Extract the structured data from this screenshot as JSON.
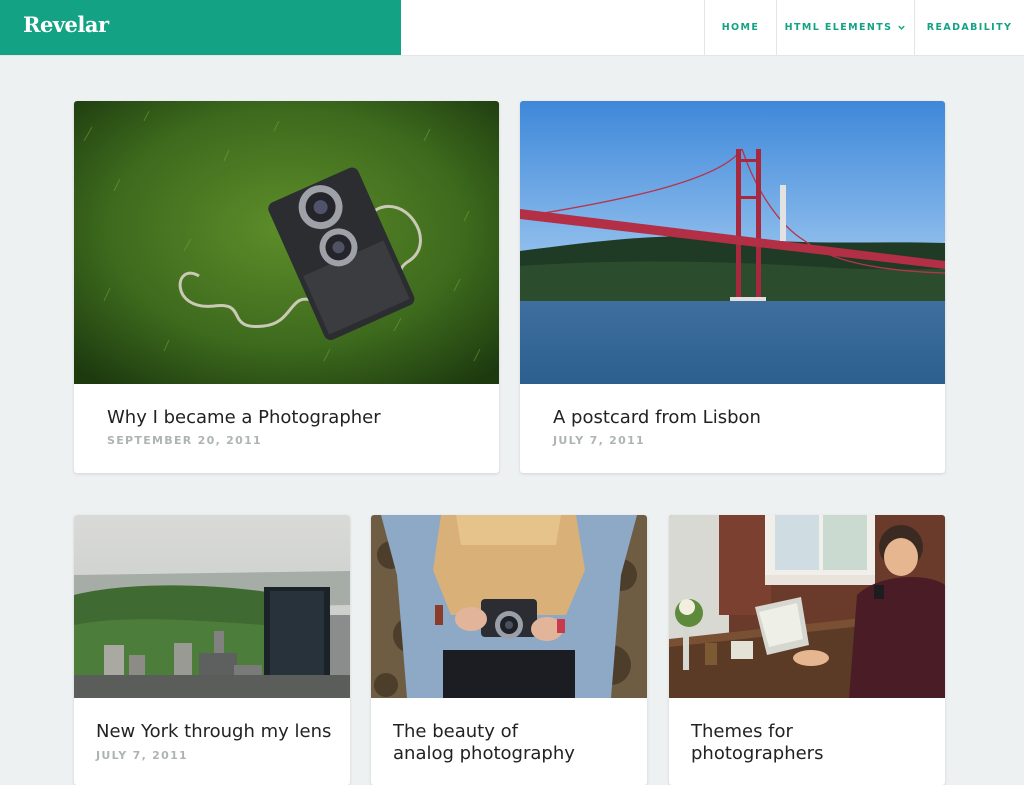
{
  "site": {
    "name": "Revelar",
    "brand_color": "#14a284"
  },
  "nav": {
    "home": "HOME",
    "html_elements": "HTML ELEMENTS",
    "readability": "READABILITY"
  },
  "posts": [
    {
      "title": "Why I became a Photographer",
      "date": "SEPTEMBER 20, 2011"
    },
    {
      "title": "A postcard from Lisbon",
      "date": "JULY 7, 2011"
    },
    {
      "title": "New York through my lens",
      "date": "JULY 7, 2011"
    },
    {
      "title": "The beauty of\nanalog photography"
    },
    {
      "title": "Themes for\nphotographers"
    }
  ]
}
